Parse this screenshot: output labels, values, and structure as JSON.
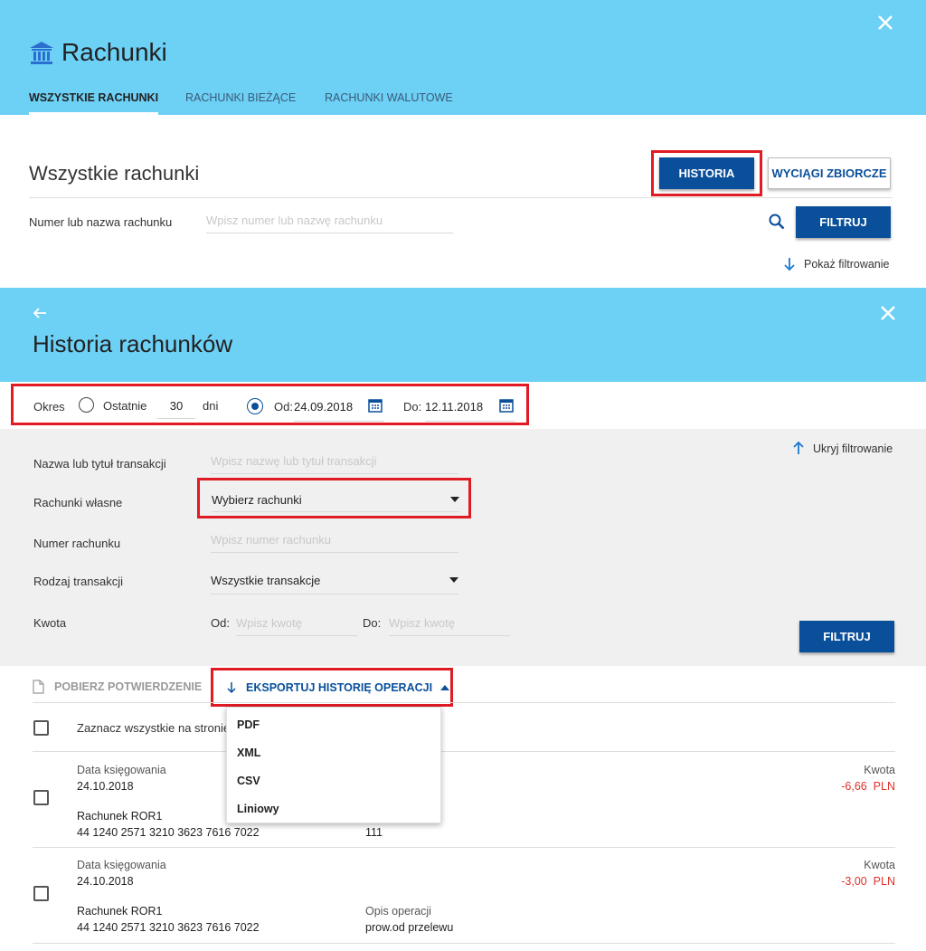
{
  "top": {
    "title": "Rachunki",
    "tabs": [
      {
        "label": "WSZYSTKIE RACHUNKI"
      },
      {
        "label": "RACHUNKI BIEŻĄCE"
      },
      {
        "label": "RACHUNKI WALUTOWE"
      }
    ],
    "section_title": "Wszystkie rachunki",
    "historia_button": "HISTORIA",
    "wyciagi_button": "WYCIĄGI ZBIORCZE",
    "account_filter_label": "Numer lub nazwa rachunku",
    "account_filter_placeholder": "Wpisz numer lub nazwę rachunku",
    "filter_button": "FILTRUJ",
    "show_filter_link": "Pokaż filtrowanie"
  },
  "history": {
    "title": "Historia rachunków",
    "period": {
      "label": "Okres",
      "last_label": "Ostatnie",
      "last_days_value": "30",
      "days_label": "dni",
      "from_label": "Od:",
      "from_value": "24.09.2018",
      "to_label": "Do:",
      "to_value": "12.11.2018",
      "selected": "range"
    },
    "filters": {
      "hide_filter_link": "Ukryj filtrowanie",
      "transaction_name_label": "Nazwa lub tytuł transakcji",
      "transaction_name_placeholder": "Wpisz nazwę lub tytuł transakcji",
      "own_accounts_label": "Rachunki własne",
      "own_accounts_value": "Wybierz rachunki",
      "account_number_label": "Numer rachunku",
      "account_number_placeholder": "Wpisz numer rachunku",
      "transaction_type_label": "Rodzaj transakcji",
      "transaction_type_value": "Wszystkie transakcje",
      "amount_label": "Kwota",
      "amount_from_label": "Od:",
      "amount_from_placeholder": "Wpisz kwotę",
      "amount_to_label": "Do:",
      "amount_to_placeholder": "Wpisz kwotę",
      "filter_button": "FILTRUJ"
    },
    "actions": {
      "download_confirmation": "POBIERZ POTWIERDZENIE",
      "export_history": "EKSPORTUJ HISTORIĘ OPERACJI",
      "export_options": [
        "PDF",
        "XML",
        "CSV",
        "Liniowy"
      ]
    },
    "select_all_label": "Zaznacz wszystkie na stronie",
    "transactions": [
      {
        "date_label": "Data księgowania",
        "date": "24.10.2018",
        "account_name": "Rachunek ROR1",
        "account_number": "44 1240 2571 3210 3623 7616 7022",
        "description_label": "",
        "description": "111",
        "amount_label": "Kwota",
        "amount": "-6,66  PLN"
      },
      {
        "date_label": "Data księgowania",
        "date": "24.10.2018",
        "account_name": "Rachunek ROR1",
        "account_number": "44 1240 2571 3210 3623 7616 7022",
        "description_label": "Opis operacji",
        "description": "prow.od przelewu",
        "amount_label": "Kwota",
        "amount": "-3,00  PLN"
      }
    ]
  },
  "colors": {
    "accent": "#6dd0f5",
    "primary": "#0a4f9a",
    "highlight": "#e01b24",
    "negative": "#e0302a"
  }
}
